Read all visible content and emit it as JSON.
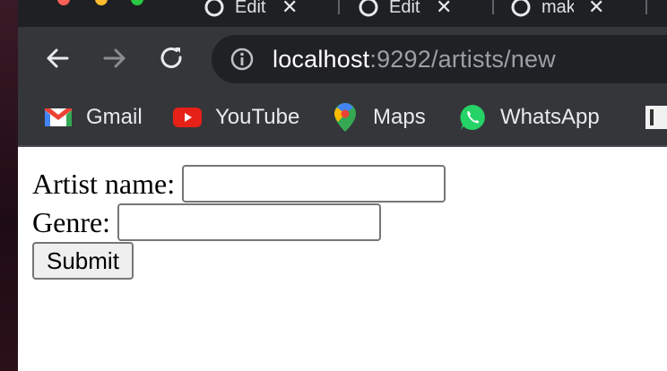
{
  "browser": {
    "tabs": [
      {
        "title": "Edit"
      },
      {
        "title": "Edit"
      },
      {
        "title": "make"
      }
    ],
    "close_glyph": "✕",
    "address": {
      "host": "localhost",
      "rest": ":9292/artists/new"
    },
    "bookmarks": [
      {
        "label": "Gmail",
        "icon": "gmail-icon"
      },
      {
        "label": "YouTube",
        "icon": "youtube-icon"
      },
      {
        "label": "Maps",
        "icon": "maps-icon"
      },
      {
        "label": "WhatsApp",
        "icon": "whatsapp-icon"
      }
    ]
  },
  "form": {
    "artist_label": "Artist name:",
    "artist_value": "",
    "genre_label": "Genre:",
    "genre_value": "",
    "submit_label": "Submit"
  },
  "colors": {
    "tabstrip": "#1f2023",
    "toolbar": "#35363a",
    "omnibox": "#202124",
    "youtube": "#e62117",
    "whatsapp": "#25d366"
  }
}
